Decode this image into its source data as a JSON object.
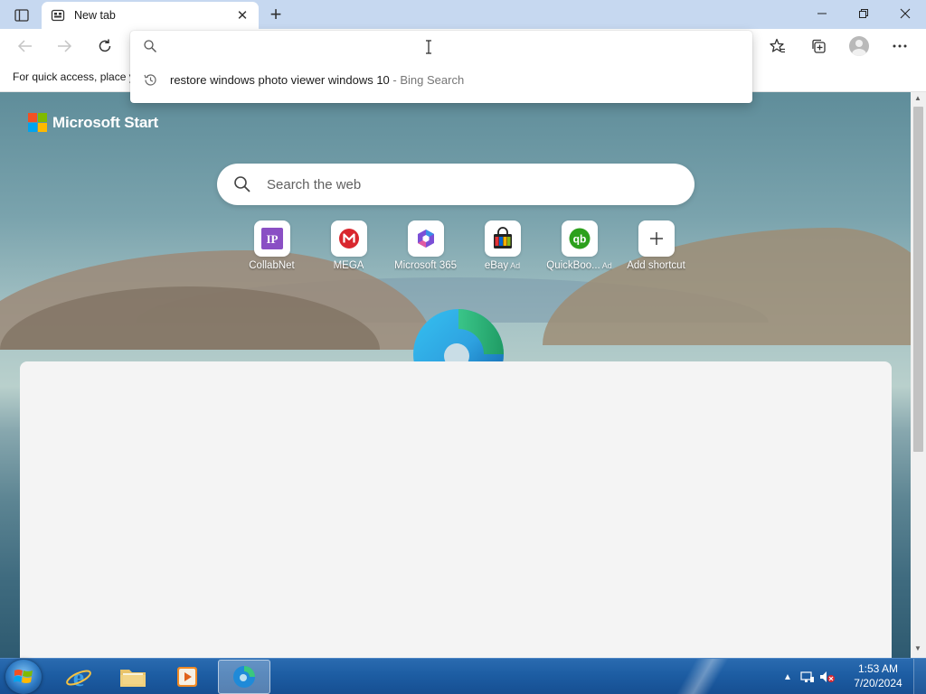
{
  "titlebar": {
    "tab_title": "New tab"
  },
  "favorites_bar": {
    "hint_text": "For quick access, place y"
  },
  "address_dropdown": {
    "input_value": "",
    "suggestion_query": "restore windows photo viewer windows 10",
    "suggestion_source": " - Bing Search"
  },
  "newtab": {
    "brand": "Microsoft Start",
    "search_placeholder": "Search the web",
    "shortcuts": [
      {
        "label": "CollabNet",
        "ad": ""
      },
      {
        "label": "MEGA",
        "ad": ""
      },
      {
        "label": "Microsoft 365",
        "ad": ""
      },
      {
        "label": "eBay",
        "ad": "Ad"
      },
      {
        "label": "QuickBoo...",
        "ad": "Ad"
      },
      {
        "label": "Add shortcut",
        "ad": ""
      }
    ]
  },
  "taskbar": {
    "time": "1:53 AM",
    "date": "7/20/2024"
  },
  "colors": {
    "titlebar": "#c6d8f0",
    "taskbar": "#1d5da3",
    "ms_red": "#f25022",
    "ms_green": "#7fba00",
    "ms_blue": "#00a4ef",
    "ms_yellow": "#ffb900"
  }
}
